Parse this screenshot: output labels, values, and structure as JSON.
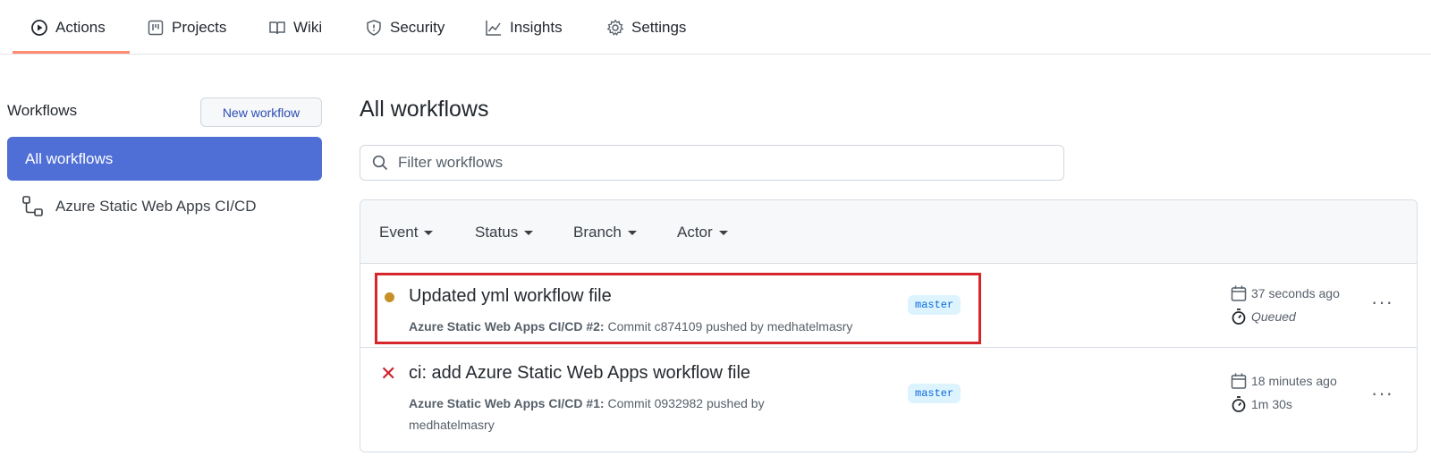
{
  "nav": {
    "tabs": [
      {
        "label": "Actions",
        "icon": "play-icon",
        "active": true
      },
      {
        "label": "Projects",
        "icon": "project-board-icon"
      },
      {
        "label": "Wiki",
        "icon": "book-icon"
      },
      {
        "label": "Security",
        "icon": "shield-icon"
      },
      {
        "label": "Insights",
        "icon": "graph-icon"
      },
      {
        "label": "Settings",
        "icon": "gear-icon"
      }
    ],
    "active_underline_color": "#fd8c73"
  },
  "sidebar": {
    "title": "Workflows",
    "new_workflow_label": "New workflow",
    "items": [
      {
        "label": "All workflows",
        "selected": true
      },
      {
        "label": "Azure Static Web Apps CI/CD",
        "icon": "workflow-icon"
      }
    ],
    "selected_color": "#4f6fd6"
  },
  "main": {
    "title": "All workflows",
    "filter_placeholder": "Filter workflows",
    "filters": [
      "Event",
      "Status",
      "Branch",
      "Actor"
    ],
    "runs": [
      {
        "status": "queued",
        "status_color": "#c69026",
        "title": "Updated yml workflow file",
        "workflow": "Azure Static Web Apps CI/CD",
        "run_number": "#2:",
        "detail": "Commit c874109 pushed by medhatelmasry",
        "branch": "master",
        "when": "37 seconds ago",
        "duration": "Queued",
        "highlighted": true
      },
      {
        "status": "failed",
        "status_glyph": "✕",
        "status_color": "#cf222e",
        "title": "ci: add Azure Static Web Apps workflow file",
        "workflow": "Azure Static Web Apps CI/CD",
        "run_number": "#1:",
        "detail": "Commit 0932982 pushed by medhatelmasry",
        "branch": "master",
        "when": "18 minutes ago",
        "duration": "1m 30s"
      }
    ],
    "more_glyph": "···"
  }
}
